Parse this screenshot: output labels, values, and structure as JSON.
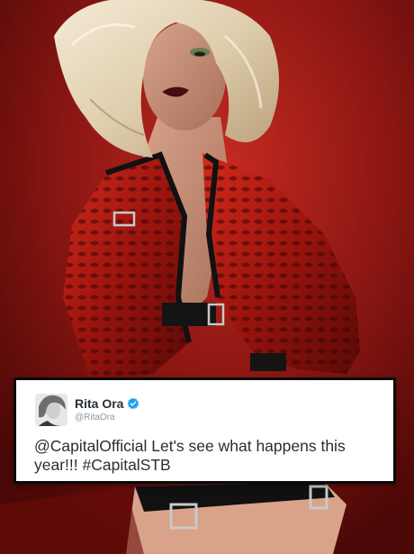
{
  "tweet": {
    "display_name": "Rita Ora",
    "handle": "@RitaOra",
    "verified": true,
    "text": "@CapitalOfficial Let's see what happens this year!!! #CapitalSTB",
    "verified_color": "#1da1f2"
  },
  "photo": {
    "icon": "portrait-photo",
    "background_color": "#8c1612",
    "hair_color": "#e9dcc2",
    "jacket_color": "#a01510"
  }
}
